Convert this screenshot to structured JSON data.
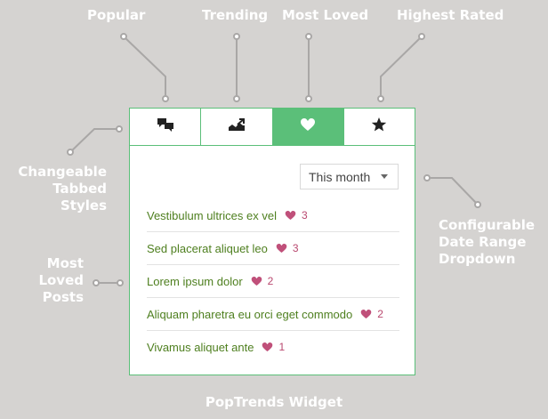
{
  "callouts": {
    "popular": "Popular",
    "trending": "Trending",
    "most_loved": "Most Loved",
    "highest_rated": "Highest Rated",
    "tabbed_styles": [
      "Changeable",
      "Tabbed",
      "Styles"
    ],
    "date_range": [
      "Configurable",
      "Date Range",
      "Dropdown"
    ],
    "loved_posts": [
      "Most",
      "Loved",
      "Posts"
    ]
  },
  "widget": {
    "tabs": [
      {
        "icon": "comments-icon"
      },
      {
        "icon": "trending-chart-icon"
      },
      {
        "icon": "heart-icon",
        "active": true
      },
      {
        "icon": "star-icon"
      }
    ],
    "dropdown": {
      "selected": "This month"
    },
    "posts": [
      {
        "title": "Vestibulum ultrices ex vel",
        "count": "3"
      },
      {
        "title": "Sed placerat aliquet leo",
        "count": "3"
      },
      {
        "title": "Lorem ipsum dolor",
        "count": "2"
      },
      {
        "title": "Aliquam pharetra eu orci eget commodo",
        "count": "2"
      },
      {
        "title": "Vivamus aliquet ante",
        "count": "1"
      }
    ]
  },
  "footer": {
    "title": "PopTrends Widget"
  },
  "colors": {
    "accent": "#5bbf79",
    "post_link": "#4e7f1f",
    "heart": "#c0507a",
    "background": "#d5d3d1"
  }
}
